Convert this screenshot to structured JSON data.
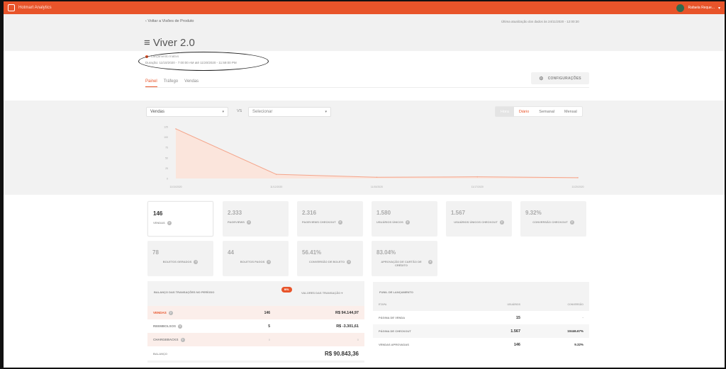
{
  "app": {
    "title": "Hotmart Analytics",
    "user_name": "Rafaela Reque..."
  },
  "header": {
    "back_label": "Voltar a Visões de Produto",
    "last_update": "Última atualização dos dados às 24/11/2020 - 12:00:30",
    "title": "≡ Viver 2.0",
    "launch_status": "Lançamento Inativo",
    "duration": "Duração: 11/10/2020 - 7:00:00 AM até 11/20/2020 - 11:59:00 PM",
    "config_label": "CONFIGURAÇÕES"
  },
  "tabs": [
    {
      "label": "Painel",
      "active": true
    },
    {
      "label": "Tráfego",
      "active": false
    },
    {
      "label": "Vendas",
      "active": false
    }
  ],
  "controls": {
    "metric_select": "Vendas",
    "vs_label": "VS",
    "compare_select": "Selecionar",
    "period_options": [
      "Hora",
      "Diário",
      "Semanal",
      "Mensal"
    ],
    "active_period": "Diário"
  },
  "chart_data": {
    "type": "area",
    "x": [
      "11/10/2020",
      "11/12/2020",
      "11/15/2020",
      "11/17/2020",
      "11/20/2020"
    ],
    "values": [
      120,
      10,
      3,
      4,
      2
    ],
    "yticks": [
      0,
      25,
      50,
      75,
      100,
      125
    ],
    "ylim": [
      0,
      125
    ],
    "color": "#f4a58b",
    "fill": "#fbe5dc",
    "grid": false
  },
  "metrics": [
    {
      "value": "146",
      "label": "VENDAS"
    },
    {
      "value": "2.333",
      "label": "PAGEVIEWS"
    },
    {
      "value": "2.316",
      "label": "PAGEVIEWS CHECKOUT"
    },
    {
      "value": "1.580",
      "label": "USUÁRIOS ÚNICOS"
    },
    {
      "value": "1.567",
      "label": "USUÁRIOS ÚNICOS CHECKOUT"
    },
    {
      "value": "9.32%",
      "label": "CONVERSÃO CHECKOUT"
    },
    {
      "value": "78",
      "label": "BOLETOS GERADOS"
    },
    {
      "value": "44",
      "label": "BOLETOS PAGOS"
    },
    {
      "value": "56.41%",
      "label": "CONVERSÃO DE BOLETO"
    },
    {
      "value": "83.04%",
      "label": "APROVAÇÃO DE CARTÃO DE CRÉDITO"
    }
  ],
  "balance": {
    "title": "BALANÇO DAS TRANSAÇÕES NO PERÍODO",
    "currency_badge": "BRL",
    "values_label": "VALORES DAS TRANSAÇÃO ▾",
    "rows": [
      {
        "label": "VENDAS",
        "count": "146",
        "amount": "R$ 94.144,97"
      },
      {
        "label": "REEMBOLSOS",
        "count": "5",
        "amount": "R$ -3.301,61"
      },
      {
        "label": "CHARGEBACKS",
        "count": "0",
        "amount": "0"
      }
    ],
    "total_label": "BALANÇO",
    "total_amount": "R$ 90.843,36"
  },
  "funnel": {
    "title": "FUNIL DE LANÇAMENTO",
    "headers": [
      "ETAPA",
      "USUÁRIOS",
      "CONVERSÃO"
    ],
    "rows": [
      {
        "step": "PÁGINA DE VENDA",
        "users": "15",
        "conversion": "-"
      },
      {
        "step": "PÁGINA DE CHECKOUT",
        "users": "1.567",
        "conversion": "10446.67%"
      },
      {
        "step": "VENDAS APROVADAS",
        "users": "146",
        "conversion": "9.32%"
      }
    ]
  }
}
